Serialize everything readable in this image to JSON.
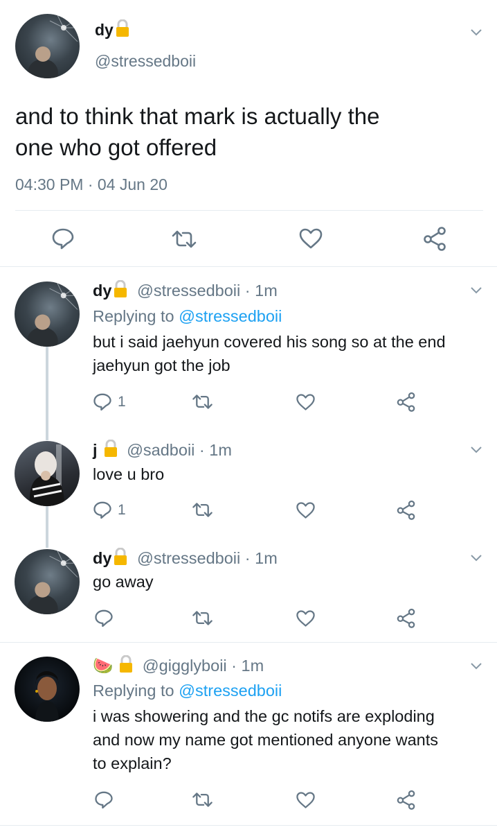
{
  "main": {
    "display_name": "dy",
    "handle": "@stressedboii",
    "text_lines": [
      "and to think that mark is actually the",
      "one who got offered"
    ],
    "timestamp": "04:30 PM",
    "date": "04 Jun 20"
  },
  "replies": [
    {
      "display_name": "dy",
      "handle": "@stressedboii",
      "time": "1m",
      "replying_label": "Replying to",
      "replying_handle": "@stressedboii",
      "text_lines": [
        "but i said jaehyun covered his song so at the end",
        "jaehyun got the job"
      ],
      "reply_count": "1"
    },
    {
      "display_name": "j",
      "handle": "@sadboii",
      "time": "1m",
      "text_lines": [
        "love u bro"
      ],
      "reply_count": "1"
    },
    {
      "display_name": "dy",
      "handle": "@stressedboii",
      "time": "1m",
      "text_lines": [
        "go away"
      ],
      "reply_count": ""
    },
    {
      "display_name": "🍉",
      "handle": "@gigglyboii",
      "time": "1m",
      "replying_label": "Replying to",
      "replying_handle": "@stressedboii",
      "text_lines": [
        "i was showering and the gc notifs are exploding",
        "and now my name got mentioned anyone wants",
        "to explain?"
      ],
      "reply_count": ""
    }
  ],
  "separator": "·",
  "icons": [
    "reply-icon",
    "retweet-icon",
    "like-icon",
    "share-icon",
    "lock-icon",
    "chevron-down-icon"
  ],
  "colors": {
    "text": "#14171a",
    "muted": "#657786",
    "link": "#1da1f2",
    "lock": "#f5b700",
    "divider": "#e6ecf0",
    "thread": "#ccd6dd"
  }
}
